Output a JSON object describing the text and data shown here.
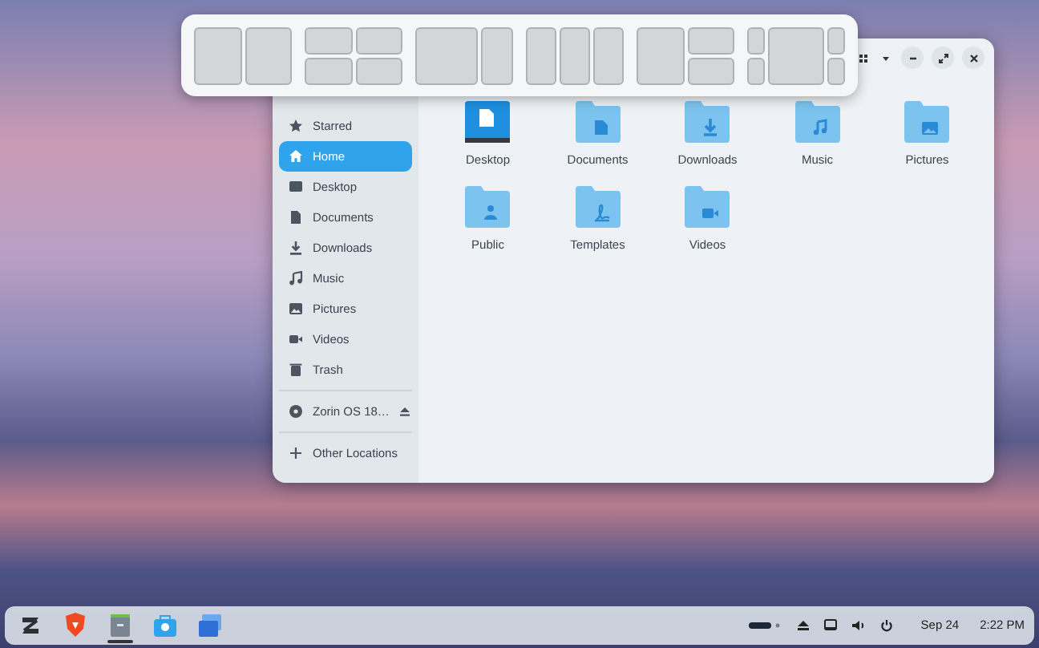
{
  "snap_layouts": [
    {
      "kind": "halves"
    },
    {
      "kind": "quarters"
    },
    {
      "kind": "wide-narrow"
    },
    {
      "kind": "thirds"
    },
    {
      "kind": "half-split"
    },
    {
      "kind": "center-sides"
    }
  ],
  "window_controls": [
    {
      "kind": "view"
    },
    {
      "kind": "dropdown"
    },
    {
      "kind": "minimize"
    },
    {
      "kind": "maximize"
    },
    {
      "kind": "close"
    }
  ],
  "sidebar": {
    "items": [
      {
        "label": "Starred",
        "kind": "star",
        "selected": false
      },
      {
        "label": "Home",
        "kind": "home",
        "selected": true
      },
      {
        "label": "Desktop",
        "kind": "desktop",
        "selected": false
      },
      {
        "label": "Documents",
        "kind": "document",
        "selected": false
      },
      {
        "label": "Downloads",
        "kind": "download",
        "selected": false
      },
      {
        "label": "Music",
        "kind": "music",
        "selected": false
      },
      {
        "label": "Pictures",
        "kind": "picture",
        "selected": false
      },
      {
        "label": "Videos",
        "kind": "video",
        "selected": false
      },
      {
        "label": "Trash",
        "kind": "trash",
        "selected": false
      },
      {
        "label": "Zorin OS 18…",
        "kind": "disk",
        "selected": false,
        "ejectable": true
      },
      {
        "label": "Other Locations",
        "kind": "plus",
        "selected": false
      }
    ]
  },
  "folders": [
    {
      "label": "Desktop",
      "kind": "desktop"
    },
    {
      "label": "Documents",
      "kind": "document"
    },
    {
      "label": "Downloads",
      "kind": "download"
    },
    {
      "label": "Music",
      "kind": "music"
    },
    {
      "label": "Pictures",
      "kind": "picture"
    },
    {
      "label": "Public",
      "kind": "public"
    },
    {
      "label": "Templates",
      "kind": "template"
    },
    {
      "label": "Videos",
      "kind": "video"
    }
  ],
  "taskbar": {
    "apps": [
      {
        "kind": "logo",
        "active": false
      },
      {
        "kind": "browser",
        "active": false
      },
      {
        "kind": "files",
        "active": true
      },
      {
        "kind": "store",
        "active": false
      },
      {
        "kind": "window",
        "active": false
      }
    ],
    "tray": [
      {
        "kind": "battery"
      },
      {
        "kind": "eject"
      },
      {
        "kind": "screen"
      },
      {
        "kind": "volume"
      },
      {
        "kind": "power"
      }
    ],
    "date": "Sep 24",
    "time": "2:22 PM"
  }
}
